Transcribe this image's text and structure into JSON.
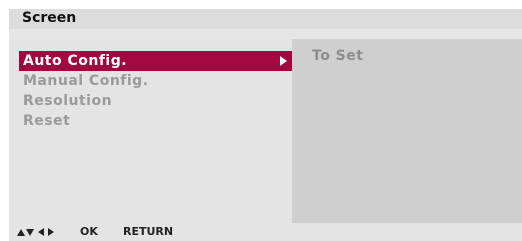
{
  "header": {
    "title": "Screen"
  },
  "menu": {
    "items": [
      {
        "label": "Auto Config.",
        "selected": true
      },
      {
        "label": "Manual Config.",
        "selected": false
      },
      {
        "label": "Resolution",
        "selected": false
      },
      {
        "label": "Reset",
        "selected": false
      }
    ]
  },
  "submenu": {
    "value": "To Set"
  },
  "footer": {
    "nav_icon": "up-down-left-right-arrows",
    "ok_label": "OK",
    "return_label": "RETURN"
  },
  "colors": {
    "highlight": "#a3073f",
    "panel_left": "#e4e4e4",
    "panel_right": "#cfcfcf"
  }
}
